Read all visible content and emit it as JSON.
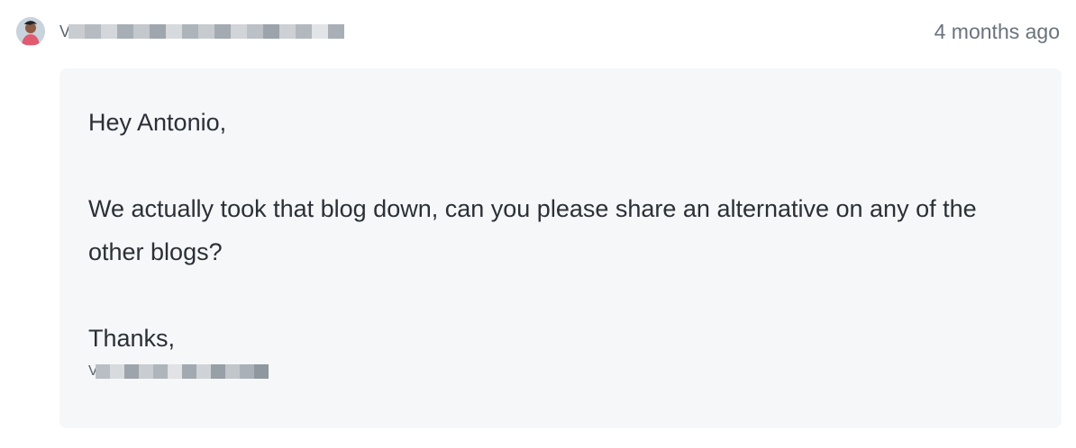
{
  "comment": {
    "author": {
      "avatar_icon": "avatar-icon",
      "name_initial": "V",
      "name_redacted": true
    },
    "timestamp": "4 months ago",
    "body": {
      "greeting": "Hey Antonio,",
      "message": "We actually took that blog down, can you please share an alternative on any of the other blogs?",
      "closing": "Thanks,",
      "signature_initial": "V",
      "signature_redacted": true
    }
  },
  "colors": {
    "body_background": "#f6f7f9",
    "text": "#2b3036",
    "muted_text": "#6a737d",
    "redaction_dark": "#9aa1a8",
    "redaction_light": "#d9dde1"
  }
}
